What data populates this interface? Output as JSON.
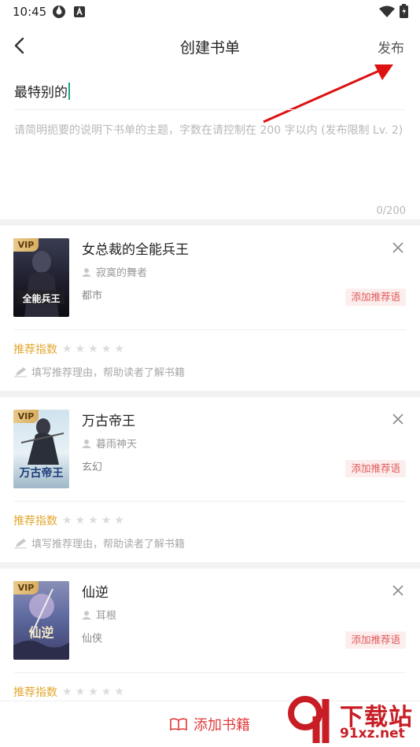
{
  "status_bar": {
    "time": "10:45"
  },
  "nav": {
    "title": "创建书单",
    "publish": "发布"
  },
  "list_name": "最特别的",
  "description": {
    "placeholder": "请简明扼要的说明下书单的主题，字数在请控制在 200 字以内 (发布限制 Lv. 2)",
    "counter": "0/200"
  },
  "books": [
    {
      "title": "女总裁的全能兵王",
      "author": "寂寞的舞者",
      "genre": "都市",
      "vip": "VIP",
      "add_rec": "添加推荐语",
      "rec_index_label": "推荐指数",
      "reason_placeholder": "填写推荐理由，帮助读者了解书籍",
      "rating": 0,
      "cover_text": "全能兵王"
    },
    {
      "title": "万古帝王",
      "author": "暮雨神天",
      "genre": "玄幻",
      "vip": "VIP",
      "add_rec": "添加推荐语",
      "rec_index_label": "推荐指数",
      "reason_placeholder": "填写推荐理由，帮助读者了解书籍",
      "rating": 0,
      "cover_text": "万古帝王"
    },
    {
      "title": "仙逆",
      "author": "耳根",
      "genre": "仙侠",
      "vip": "VIP",
      "add_rec": "添加推荐语",
      "rec_index_label": "推荐指数",
      "reason_placeholder": "",
      "rating": 0,
      "cover_text": "仙逆"
    }
  ],
  "bottom": {
    "add_books": "添加书籍"
  },
  "watermark": {
    "text": "下载站",
    "url": "91xz.net"
  },
  "colors": {
    "accent_red": "#e0393a",
    "rec_gold": "#e2a72e",
    "cursor": "#1aa58a"
  }
}
